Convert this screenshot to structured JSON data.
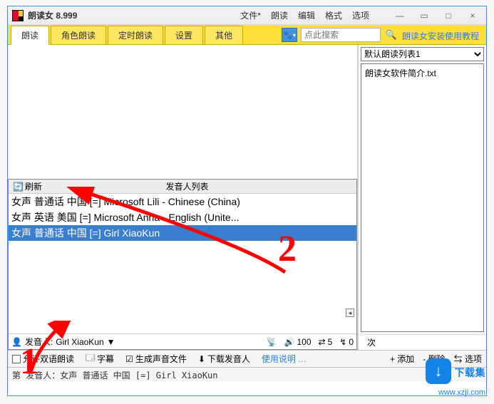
{
  "title": "朗读女 8.999",
  "menubar": [
    "文件*",
    "朗读",
    "编辑",
    "格式",
    "选项"
  ],
  "window_controls": {
    "min": "—",
    "under": "▭",
    "max": "□",
    "close": "×"
  },
  "tabs": [
    "朗读",
    "角色朗读",
    "定时朗读",
    "设置",
    "其他"
  ],
  "active_tab": 0,
  "search": {
    "placeholder": "点此搜索"
  },
  "help_link": "朗读女安装使用教程",
  "voice_panel": {
    "refresh": "刷新",
    "title": "发音人列表",
    "rows": [
      "女声 普通话 中国 [=] Microsoft Lili - Chinese (China)",
      "女声 英语 美国 [=] Microsoft Anna - English (Unite...",
      "女声 普通话 中国 [=] Girl XiaoKun"
    ],
    "selected_index": 2
  },
  "voice_bottom": {
    "label": "发音人:",
    "name": "Girl XiaoKun",
    "vol_label": "100",
    "speed_label": "5",
    "pitch_label": "0"
  },
  "toolbar": {
    "allow_dual": "允许双语朗读",
    "subtitle": "字幕",
    "gen_audio": "生成声音文件",
    "download_voice": "下载发音人",
    "usage": "使用说明",
    "add": "+ 添加",
    "del": "- 删除",
    "opt": "⇆ 选项"
  },
  "right": {
    "playlist_select": "默认朗读列表1",
    "files": [
      "朗读女软件简介.txt"
    ],
    "count_suffix": "次",
    "collapse": "◂"
  },
  "status": "第   发音人：女声 普通话 中国 [=] Girl XiaoKun",
  "annotations": {
    "a1": "1",
    "a2": "2"
  },
  "watermark": {
    "logo": "↓",
    "text": "下载集",
    "url": "www.xzji.com"
  }
}
